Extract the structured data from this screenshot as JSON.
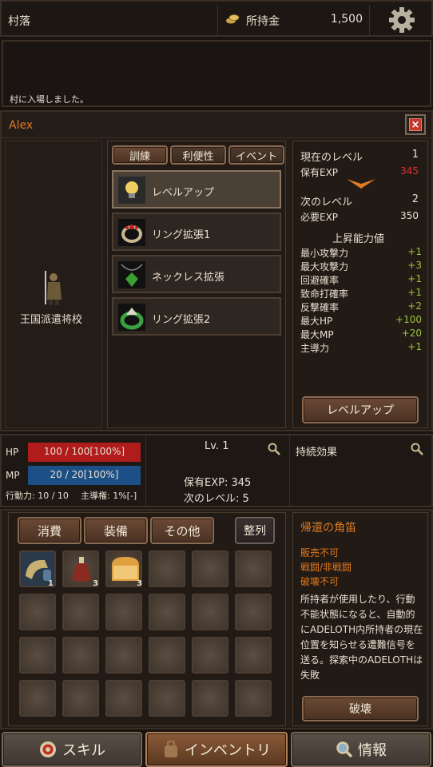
{
  "topbar": {
    "location": "村落",
    "money_label": "所持金",
    "money_value": "1,500"
  },
  "log": {
    "message": "村に入場しました。"
  },
  "character": {
    "name": "Alex",
    "title": "王国派遣将校"
  },
  "tabs": [
    "訓練",
    "利便性",
    "イベント"
  ],
  "training_items": [
    {
      "label": "レベルアップ",
      "icon": "lightbulb-icon"
    },
    {
      "label": "リング拡張1",
      "icon": "ring-icon"
    },
    {
      "label": "ネックレス拡張",
      "icon": "necklace-icon"
    },
    {
      "label": "リング拡張2",
      "icon": "green-ring-icon"
    }
  ],
  "level_panel": {
    "current_level_label": "現在のレベル",
    "current_level": "1",
    "owned_exp_label": "保有EXP",
    "owned_exp": "345",
    "next_level_label": "次のレベル",
    "next_level": "2",
    "required_exp_label": "必要EXP",
    "required_exp": "350",
    "gain_title": "上昇能力値",
    "stats": [
      {
        "label": "最小攻撃力",
        "value": "+1"
      },
      {
        "label": "最大攻撃力",
        "value": "+3"
      },
      {
        "label": "回避確率",
        "value": "+1"
      },
      {
        "label": "致命打確率",
        "value": "+1"
      },
      {
        "label": "反撃確率",
        "value": "+2"
      },
      {
        "label": "最大HP",
        "value": "+100"
      },
      {
        "label": "最大MP",
        "value": "+20"
      },
      {
        "label": "主導力",
        "value": "+1"
      }
    ],
    "button_label": "レベルアップ"
  },
  "status": {
    "hp_label": "HP",
    "hp_text": "100 / 100[100%]",
    "hp_fill": 1.0,
    "mp_label": "MP",
    "mp_text": "20 / 20[100%]",
    "mp_fill": 1.0,
    "action_text": "行動力: 10 / 10",
    "lead_text": "主導権: 1%[-]",
    "lv_text": "Lv. 1",
    "exp_text": "保有EXP: 345",
    "next_text": "次のレベル: 5",
    "effects_label": "持続効果"
  },
  "inventory": {
    "tabs": [
      "消費",
      "装備",
      "その他"
    ],
    "sort_label": "整列",
    "items": [
      {
        "icon": "horn-icon",
        "count": "1"
      },
      {
        "icon": "potion-icon",
        "count": "3"
      },
      {
        "icon": "bread-icon",
        "count": "3"
      }
    ]
  },
  "item_detail": {
    "name": "帰還の角笛",
    "props": [
      "販売不可",
      "戦闘/非戦闘",
      "破壊不可"
    ],
    "desc": "所持者が使用したり、行動不能状態になると、自動的にADELOTH内所持者の現在位置を知らせる遭難信号を送る。探索中のADELOTHは失敗",
    "button_label": "破壊"
  },
  "bottom_nav": [
    {
      "label": "スキル",
      "icon": "target-icon"
    },
    {
      "label": "インベントリ",
      "icon": "bag-icon"
    },
    {
      "label": "情報",
      "icon": "magnifier-icon"
    }
  ],
  "colors": {
    "accent_orange": "#e07a20",
    "exp_red": "#e03030",
    "stat_green": "#9ec43a",
    "hp_red": "#b01c1c",
    "mp_blue": "#1c4f86"
  }
}
